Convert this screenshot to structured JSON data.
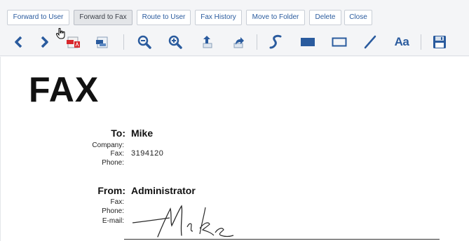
{
  "commands": [
    {
      "id": "forward-to-user",
      "label": "Forward to User",
      "active": false
    },
    {
      "id": "forward-to-fax",
      "label": "Forward to Fax",
      "active": true
    },
    {
      "id": "route-to-user",
      "label": "Route to User",
      "active": false
    },
    {
      "id": "fax-history",
      "label": "Fax History",
      "active": false
    },
    {
      "id": "move-to-folder",
      "label": "Move to Folder",
      "active": false
    },
    {
      "id": "delete",
      "label": "Delete",
      "active": false
    },
    {
      "id": "close",
      "label": "Close",
      "active": false
    }
  ],
  "toolbar": {
    "icons": [
      "prev-page-icon",
      "next-page-icon",
      "pdf-icon",
      "tiff-icon",
      "zoom-out-icon",
      "zoom-in-icon",
      "rotate-left-icon",
      "rotate-right-icon",
      "freehand-draw-icon",
      "filled-rectangle-icon",
      "rectangle-icon",
      "line-icon",
      "text-tool-icon",
      "save-icon"
    ],
    "text_tool_label": "Aa",
    "accent_color": "#2a5b9e"
  },
  "document": {
    "heading": "FAX",
    "to": {
      "label": "To:",
      "name": "Mike"
    },
    "to_fields": [
      {
        "label": "Company:",
        "value": ""
      },
      {
        "label": "Fax:",
        "value": "3194120"
      },
      {
        "label": "Phone:",
        "value": ""
      }
    ],
    "from": {
      "label": "From:",
      "name": "Administrator"
    },
    "from_fields": [
      {
        "label": "Fax:",
        "value": ""
      },
      {
        "label": "Phone:",
        "value": ""
      },
      {
        "label": "E-mail:",
        "value": ""
      }
    ]
  }
}
